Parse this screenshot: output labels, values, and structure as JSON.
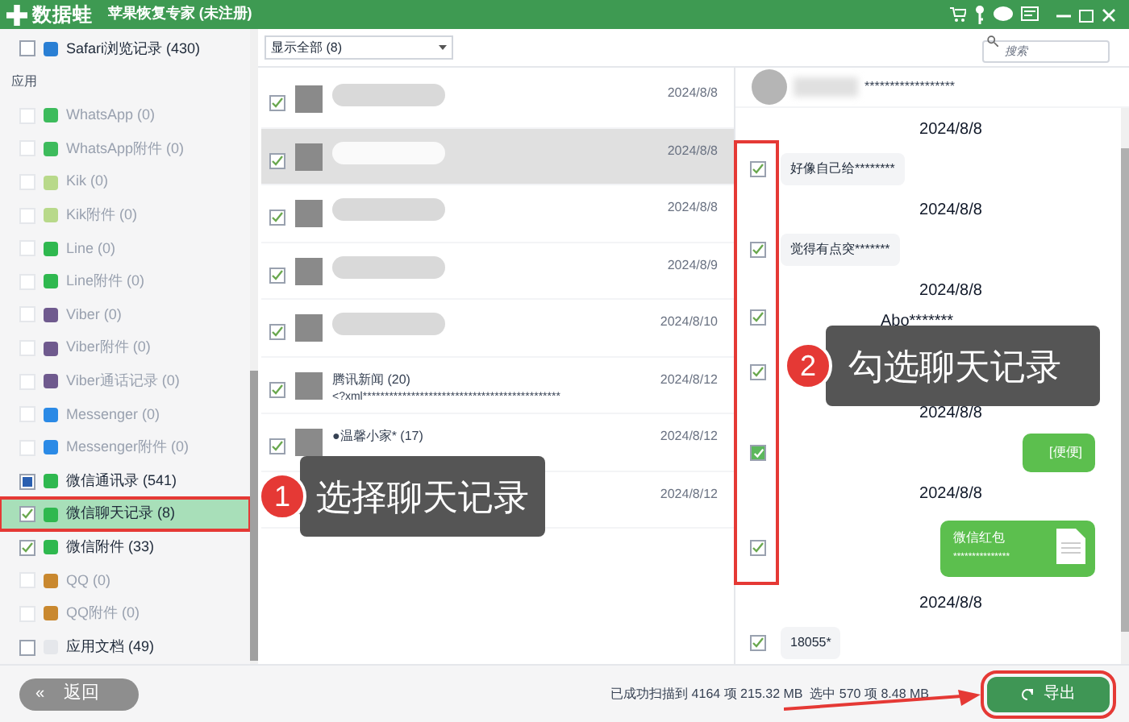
{
  "titlebar": {
    "logo": "数据蛙",
    "title": "苹果恢复专家 (未注册)"
  },
  "sidebar": {
    "items": [
      {
        "kind": "item",
        "label": "Safari浏览记录 (430)",
        "checked": false,
        "partial": false,
        "disabled": false,
        "selected": false,
        "color": "#2a7fd4"
      },
      {
        "kind": "header",
        "label": "应用"
      },
      {
        "kind": "item",
        "label": "WhatsApp (0)",
        "checked": false,
        "partial": false,
        "disabled": true,
        "selected": false,
        "color": "#3dbb5c"
      },
      {
        "kind": "item",
        "label": "WhatsApp附件 (0)",
        "checked": false,
        "partial": false,
        "disabled": true,
        "selected": false,
        "color": "#3dbb5c"
      },
      {
        "kind": "item",
        "label": "Kik (0)",
        "checked": false,
        "partial": false,
        "disabled": true,
        "selected": false,
        "color": "#b8d98a"
      },
      {
        "kind": "item",
        "label": "Kik附件 (0)",
        "checked": false,
        "partial": false,
        "disabled": true,
        "selected": false,
        "color": "#b8d98a"
      },
      {
        "kind": "item",
        "label": "Line (0)",
        "checked": false,
        "partial": false,
        "disabled": true,
        "selected": false,
        "color": "#2fb84f"
      },
      {
        "kind": "item",
        "label": "Line附件 (0)",
        "checked": false,
        "partial": false,
        "disabled": true,
        "selected": false,
        "color": "#2fb84f"
      },
      {
        "kind": "item",
        "label": "Viber (0)",
        "checked": false,
        "partial": false,
        "disabled": true,
        "selected": false,
        "color": "#6f5a8e"
      },
      {
        "kind": "item",
        "label": "Viber附件 (0)",
        "checked": false,
        "partial": false,
        "disabled": true,
        "selected": false,
        "color": "#6f5a8e"
      },
      {
        "kind": "item",
        "label": "Viber通话记录 (0)",
        "checked": false,
        "partial": false,
        "disabled": true,
        "selected": false,
        "color": "#6f5a8e"
      },
      {
        "kind": "item",
        "label": "Messenger (0)",
        "checked": false,
        "partial": false,
        "disabled": true,
        "selected": false,
        "color": "#2b8ae6"
      },
      {
        "kind": "item",
        "label": "Messenger附件 (0)",
        "checked": false,
        "partial": false,
        "disabled": true,
        "selected": false,
        "color": "#2b8ae6"
      },
      {
        "kind": "item",
        "label": "微信通讯录 (541)",
        "checked": true,
        "partial": true,
        "disabled": false,
        "selected": false,
        "color": "#2fb84f"
      },
      {
        "kind": "item",
        "label": "微信聊天记录 (8)",
        "checked": true,
        "partial": false,
        "disabled": false,
        "selected": true,
        "color": "#2fb84f"
      },
      {
        "kind": "item",
        "label": "微信附件 (33)",
        "checked": true,
        "partial": false,
        "disabled": false,
        "selected": false,
        "color": "#2fb84f"
      },
      {
        "kind": "item",
        "label": "QQ (0)",
        "checked": false,
        "partial": false,
        "disabled": true,
        "selected": false,
        "color": "#c9882f"
      },
      {
        "kind": "item",
        "label": "QQ附件 (0)",
        "checked": false,
        "partial": false,
        "disabled": true,
        "selected": false,
        "color": "#c9882f"
      },
      {
        "kind": "item",
        "label": "应用文档 (49)",
        "checked": false,
        "partial": false,
        "disabled": false,
        "selected": false,
        "color": "#e5e7eb"
      }
    ]
  },
  "filter": {
    "value": "显示全部 (8)"
  },
  "search": {
    "placeholder": "搜索"
  },
  "conversations": [
    {
      "date": "2024/8/8",
      "checked": true,
      "selected": false
    },
    {
      "date": "2024/8/8",
      "checked": true,
      "selected": true
    },
    {
      "date": "2024/8/8",
      "checked": true,
      "selected": false
    },
    {
      "date": "2024/8/9",
      "checked": true,
      "selected": false
    },
    {
      "date": "2024/8/10",
      "checked": true,
      "selected": false
    },
    {
      "name": "腾讯新闻 (20)",
      "preview": "<?xml*********************************************",
      "date": "2024/8/12",
      "checked": true,
      "selected": false
    },
    {
      "name": "●温馨小家* (17)",
      "date": "2024/8/12",
      "checked": true,
      "selected": false
    },
    {
      "date": "2024/8/12",
      "selected": false
    }
  ],
  "chat": {
    "header": "******************",
    "messages": [
      {
        "kind": "date",
        "text": "2024/8/8"
      },
      {
        "kind": "in",
        "text": "好像自己给********",
        "checked": true
      },
      {
        "kind": "date",
        "text": "2024/8/8"
      },
      {
        "kind": "in",
        "text": "觉得有点突*******",
        "checked": true
      },
      {
        "kind": "date",
        "text": "2024/8/8"
      },
      {
        "kind": "plain",
        "text": "Abo*******",
        "checked": true
      },
      {
        "kind": "out",
        "checked": true
      },
      {
        "kind": "date",
        "text": "2024/8/8"
      },
      {
        "kind": "out",
        "text": "[便便]",
        "checked": true
      },
      {
        "kind": "date",
        "text": "2024/8/8"
      },
      {
        "kind": "card",
        "text": "微信红包",
        "sub": "***************",
        "checked": true
      },
      {
        "kind": "date",
        "text": "2024/8/8"
      },
      {
        "kind": "in",
        "text": "18055*",
        "checked": true
      }
    ]
  },
  "status": "已成功扫描到 4164 项 215.32 MB  选中 570 项 8.48 MB",
  "buttons": {
    "back_icon": "«",
    "back": "返回",
    "export": "导出"
  },
  "callouts": [
    {
      "number": "1",
      "text": "选择聊天记录"
    },
    {
      "number": "2",
      "text": "勾选聊天记录"
    }
  ]
}
